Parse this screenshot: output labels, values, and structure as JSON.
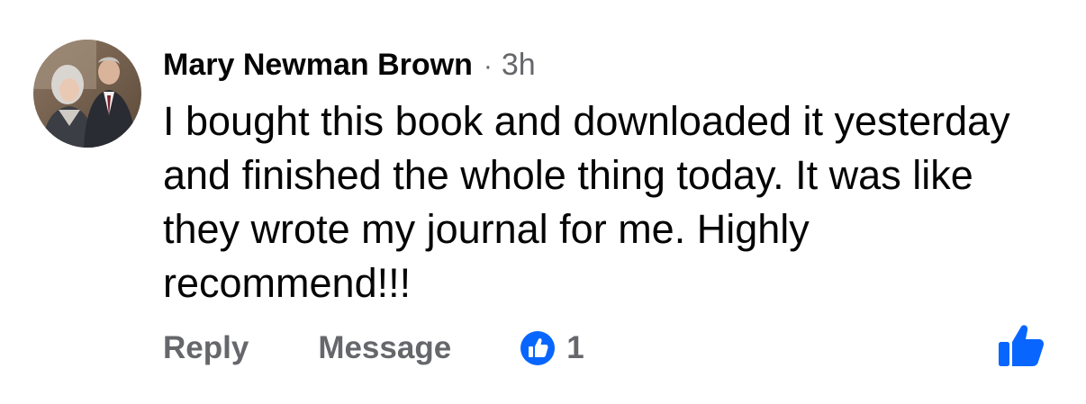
{
  "comment": {
    "author": "Mary Newman Brown",
    "separator": "·",
    "time": "3h",
    "body": "I bought this book and downloaded it yesterday and finished the whole thing today. It was like they wrote my journal for me. Highly recommend!!!"
  },
  "actions": {
    "reply_label": "Reply",
    "message_label": "Message",
    "reaction_count": "1"
  },
  "icons": {
    "reaction": "like-reaction-icon",
    "like_button": "thumbs-up-icon"
  },
  "colors": {
    "brand_blue": "#0866ff",
    "secondary_text": "#65676b",
    "primary_text": "#050505"
  }
}
